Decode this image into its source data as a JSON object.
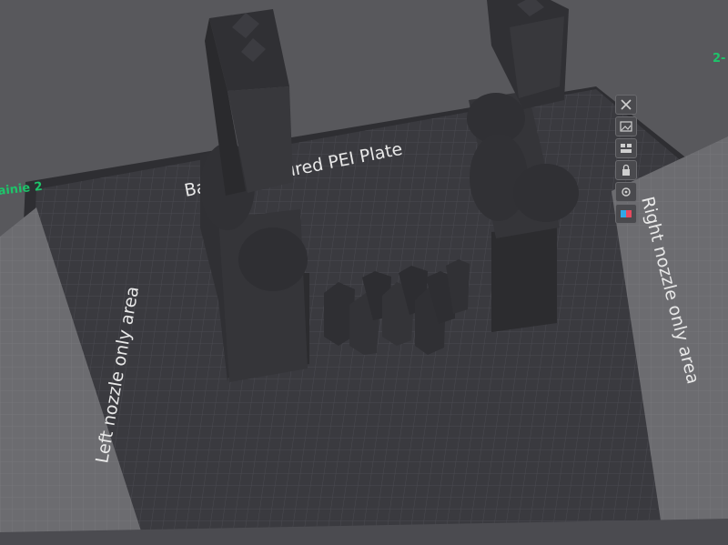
{
  "scene": {
    "plate_name": "Bambu Textured PEI Plate",
    "left_area_label": "Left nozzle only area",
    "right_area_label": "Right nozzle only area",
    "left_corner_label": "ainie 2",
    "right_corner_label": "2-"
  },
  "toolbar": {
    "items": [
      {
        "name": "close-plate",
        "icon": "close-icon"
      },
      {
        "name": "pick-image",
        "icon": "image-icon"
      },
      {
        "name": "arrange",
        "icon": "arrange-icon"
      },
      {
        "name": "lock",
        "icon": "lock-icon"
      },
      {
        "name": "settings",
        "icon": "gear-icon"
      },
      {
        "name": "filament-colors",
        "icon": "color-swatch-icon"
      }
    ]
  },
  "colors": {
    "background": "#58585c",
    "plate": "#3a3a3f",
    "grid_line": "#4a4a50",
    "side_area": "#6c6c70",
    "model": "#333336",
    "label_green": "#1ec46a"
  }
}
